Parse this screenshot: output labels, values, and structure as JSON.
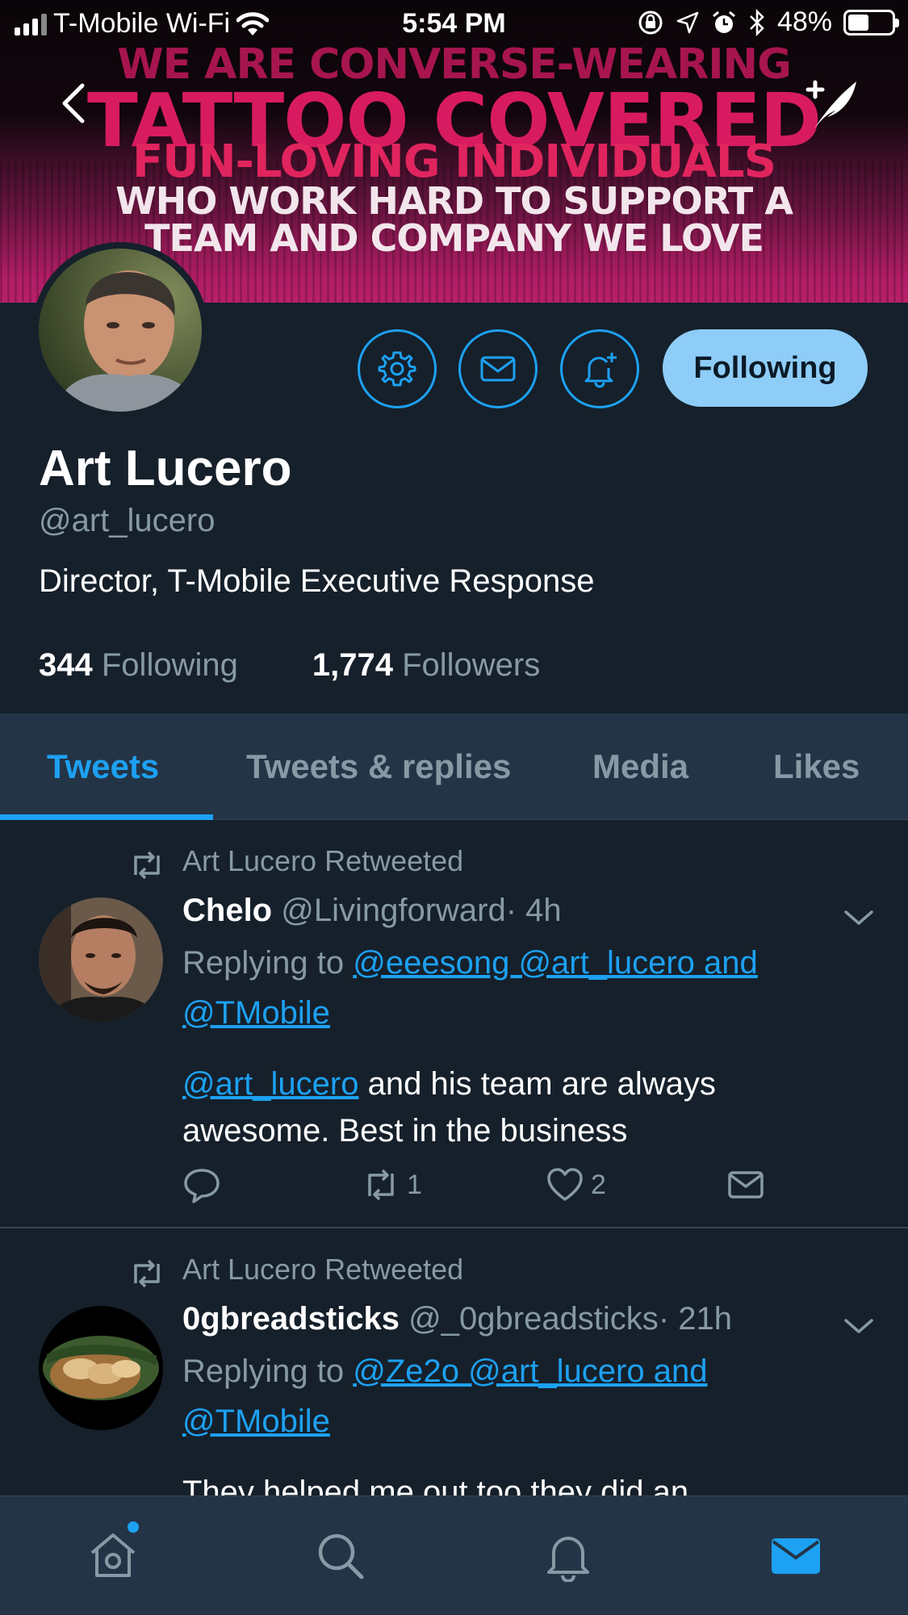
{
  "status_bar": {
    "carrier": "T-Mobile Wi-Fi",
    "time": "5:54 PM",
    "battery": "48%",
    "battery_level": 0.48
  },
  "banner": {
    "lines": [
      "WE ARE CONVERSE-WEARING",
      "TATTOO COVERED",
      "FUN-LOVING INDIVIDUALS",
      "WHO WORK HARD TO SUPPORT A",
      "TEAM AND COMPANY WE LOVE"
    ]
  },
  "profile": {
    "name": "Art Lucero",
    "handle": "@art_lucero",
    "bio": "Director, T-Mobile Executive Response",
    "following_count": "344",
    "following_label": "Following",
    "followers_count": "1,774",
    "followers_label": "Followers",
    "follow_button": "Following"
  },
  "tabs": [
    "Tweets",
    "Tweets & replies",
    "Media",
    "Likes"
  ],
  "active_tab": "Tweets",
  "tweets": [
    {
      "retweet_label": "Art Lucero Retweeted",
      "name": "Chelo",
      "handle": "@Livingforward",
      "time": "· 4h",
      "replying_prefix": "Replying to",
      "replying_links_line1": "@eeesong @art_lucero and",
      "replying_links_line2": "@TMobile",
      "body_link": "@art_lucero",
      "body_text_1": " and his team are always",
      "body_text_2": "awesome. Best in the business",
      "retweets": "1",
      "likes": "2"
    },
    {
      "retweet_label": "Art Lucero Retweeted",
      "name": "0gbreadsticks",
      "handle": "@_0gbreadsticks",
      "time": "· 21h",
      "replying_prefix": "Replying to",
      "replying_links_line1": "@Ze2o @art_lucero and",
      "replying_links_line2": "@TMobile",
      "body_text_1": "They helped me out too they did an"
    }
  ],
  "bottom_nav": [
    "home-icon",
    "search-icon",
    "notifications-icon",
    "messages-icon"
  ],
  "colors": {
    "background": "#15202b",
    "accent": "#1da1f2",
    "secondary_text": "#8899a6",
    "tab_bar": "#243447",
    "follow_button": "#8ecdf8"
  }
}
